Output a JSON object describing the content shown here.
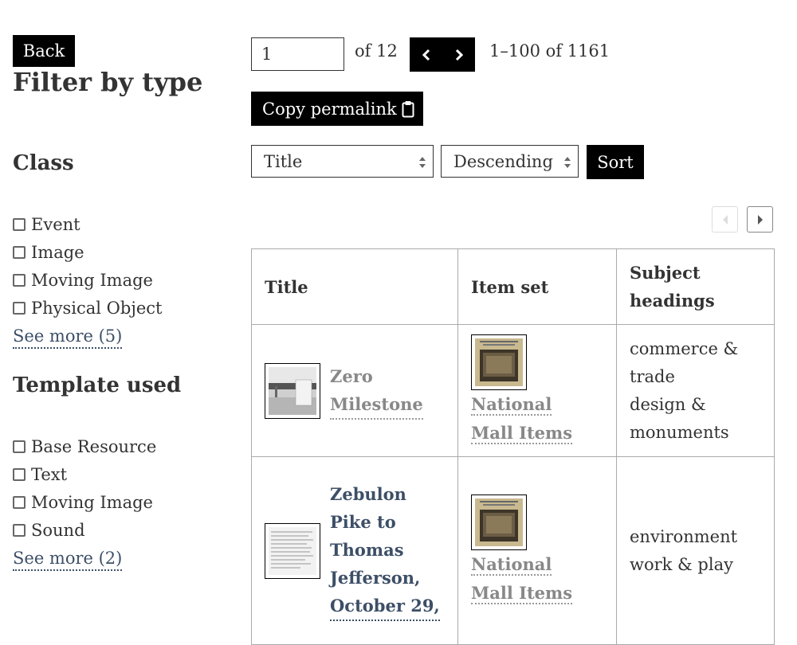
{
  "sidebar": {
    "back_label": "Back",
    "filter_heading": "Filter by type",
    "class_section": {
      "heading": "Class",
      "items": [
        {
          "label": "Event",
          "checked": false
        },
        {
          "label": "Image",
          "checked": false
        },
        {
          "label": "Moving Image",
          "checked": false
        },
        {
          "label": "Physical Object",
          "checked": false
        }
      ],
      "see_more": "See more (5)"
    },
    "template_section": {
      "heading": "Template used",
      "items": [
        {
          "label": "Base Resource",
          "checked": false
        },
        {
          "label": "Text",
          "checked": false
        },
        {
          "label": "Moving Image",
          "checked": false
        },
        {
          "label": "Sound",
          "checked": false
        }
      ],
      "see_more": "See more (2)"
    }
  },
  "pagination": {
    "current_page": "1",
    "of_total": "of 12",
    "range": "1–100 of 1161",
    "prev_icon": "chevron-left-icon",
    "next_icon": "chevron-right-icon"
  },
  "toolbar": {
    "copy_permalink_label": "Copy permalink",
    "copy_icon": "clipboard-icon",
    "sort_field": "Title",
    "sort_order": "Descending",
    "sort_label": "Sort"
  },
  "table": {
    "headers": {
      "title": "Title",
      "item_set": "Item set",
      "subject_line1": "Subject",
      "subject_line2": "headings"
    },
    "rows": [
      {
        "title_lines": [
          "Zero",
          "Milestone"
        ],
        "item_set_lines": [
          "National",
          "Mall Items"
        ],
        "subjects": [
          "commerce &",
          "trade",
          "design &",
          "monuments"
        ]
      },
      {
        "title_lines": [
          "Zebulon",
          "Pike to",
          "Thomas",
          "Jefferson,",
          "October 29,"
        ],
        "item_set_lines": [
          "National",
          "Mall Items"
        ],
        "subjects": [
          "environment",
          "work & play"
        ]
      }
    ]
  },
  "colors": {
    "link": "#3d4f67",
    "visited_link": "#888888",
    "button_bg": "#000000",
    "text": "#333333"
  }
}
